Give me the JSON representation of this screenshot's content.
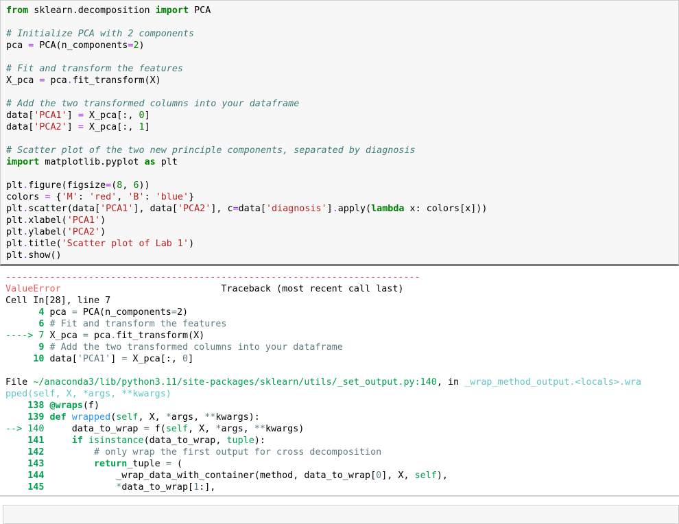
{
  "code_cell": {
    "lines": [
      "from sklearn.decomposition import PCA",
      "",
      "# Initialize PCA with 2 components",
      "pca = PCA(n_components=2)",
      "",
      "# Fit and transform the features",
      "X_pca = pca.fit_transform(X)",
      "",
      "# Add the two transformed columns into your dataframe",
      "data['PCA1'] = X_pca[:, 0]",
      "data['PCA2'] = X_pca[:, 1]",
      "",
      "# Scatter plot of the two new principle components, separated by diagnosis",
      "import matplotlib.pyplot as plt",
      "",
      "plt.figure(figsize=(8, 6))",
      "colors = {'M': 'red', 'B': 'blue'}",
      "plt.scatter(data['PCA1'], data['PCA2'], c=data['diagnosis'].apply(lambda x: colors[x]))",
      "plt.xlabel('PCA1')",
      "plt.ylabel('PCA2')",
      "plt.title('Scatter plot of Lab 1')",
      "plt.show()"
    ]
  },
  "output": {
    "dash_line": "---------------------------------------------------------------------------",
    "error_name": "ValueError",
    "traceback_header": "Traceback (most recent call last)",
    "cell_ref": "Cell In[28], line 7",
    "frame1": [
      {
        "arrow": "",
        "num": "4",
        "code": "pca = PCA(n_components=2)"
      },
      {
        "arrow": "",
        "num": "6",
        "code": "# Fit and transform the features"
      },
      {
        "arrow": "---->",
        "num": "7",
        "code": "X_pca = pca.fit_transform(X)"
      },
      {
        "arrow": "",
        "num": "9",
        "code": "# Add the two transformed columns into your dataframe"
      },
      {
        "arrow": "",
        "num": "10",
        "code": "data['PCA1'] = X_pca[:, 0]"
      }
    ],
    "file_line_1": "File ~/anaconda3/lib/python3.11/site-packages/sklearn/utils/_set_output.py:140, in _wrap_method_output.<locals>.wra",
    "file_line_2": "pped(self, X, *args, **kwargs)",
    "frame2": [
      {
        "arrow": "",
        "num": "138",
        "code": "@wraps(f)"
      },
      {
        "arrow": "",
        "num": "139",
        "code": "def wrapped(self, X, *args, **kwargs):"
      },
      {
        "arrow": "-->",
        "num": "140",
        "code": "    data_to_wrap = f(self, X, *args, **kwargs)"
      },
      {
        "arrow": "",
        "num": "141",
        "code": "    if isinstance(data_to_wrap, tuple):"
      },
      {
        "arrow": "",
        "num": "142",
        "code": "        # only wrap the first output for cross decomposition"
      },
      {
        "arrow": "",
        "num": "143",
        "code": "        return_tuple = ("
      },
      {
        "arrow": "",
        "num": "144",
        "code": "            _wrap_data_with_container(method, data_to_wrap[0], X, self),"
      },
      {
        "arrow": "",
        "num": "145",
        "code": "            *data_to_wrap[1:],"
      }
    ]
  },
  "colors": {
    "keyword": "#008000",
    "comment": "#3d7b7b",
    "string": "#ba2121",
    "error": "#e75c58",
    "traceback_green": "#00a250",
    "traceback_teal": "#60c6c8",
    "cell_bg": "#f7f7f7"
  }
}
